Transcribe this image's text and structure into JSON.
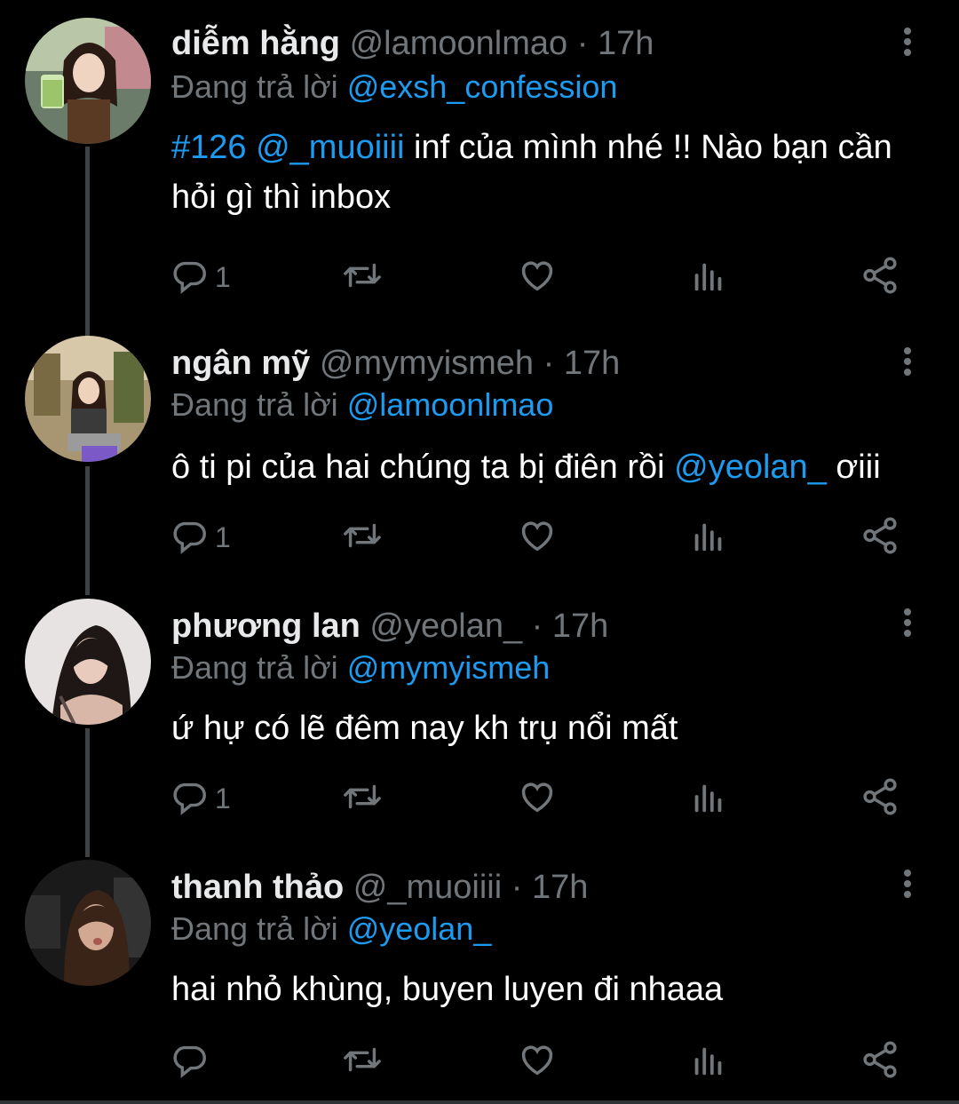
{
  "colors": {
    "background": "#000000",
    "text": "#ffffff",
    "muted": "#71767b",
    "link": "#1d9bf0",
    "thread_line": "#3e4144"
  },
  "replying_prefix": "Đang trả lời",
  "tweets": [
    {
      "display_name": "diễm hằng",
      "handle": "@lamoonlmao",
      "time": "· 17h",
      "reply_to": "@exsh_confession",
      "text_parts": [
        {
          "text": "#126 @_muoiiii",
          "link": true
        },
        {
          "text": " inf của mình nhé !! Nào bạn cần hỏi gì thì inbox",
          "link": false
        }
      ],
      "reply_count": "1"
    },
    {
      "display_name": "ngân mỹ",
      "handle": "@mymyismeh",
      "time": "· 17h",
      "reply_to": "@lamoonlmao",
      "text_parts": [
        {
          "text": "ô ti pi của hai chúng ta bị điên rồi ",
          "link": false
        },
        {
          "text": "@yeolan_",
          "link": true
        },
        {
          "text": " ơiii",
          "link": false
        }
      ],
      "reply_count": "1"
    },
    {
      "display_name": "phương lan",
      "handle": "@yeolan_",
      "time": "· 17h",
      "reply_to": "@mymyismeh",
      "text_parts": [
        {
          "text": "ứ hự có lẽ đêm nay kh trụ nổi mất",
          "link": false
        }
      ],
      "reply_count": "1"
    },
    {
      "display_name": "thanh thảo",
      "handle": "@_muoiiii",
      "time": "· 17h",
      "reply_to": "@yeolan_",
      "text_parts": [
        {
          "text": "hai nhỏ khùng, buyen luyen đi nhaaa",
          "link": false
        }
      ],
      "reply_count": ""
    }
  ],
  "icons": {
    "reply": "reply-icon",
    "retweet": "retweet-icon",
    "like": "heart-icon",
    "views": "views-icon",
    "share": "share-icon",
    "more": "more-options-icon"
  }
}
